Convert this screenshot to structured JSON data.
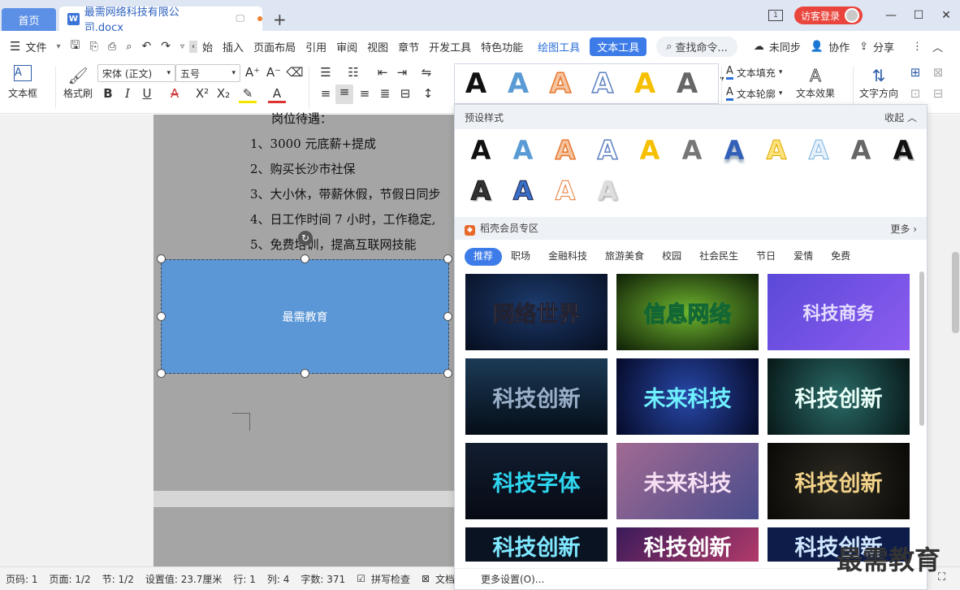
{
  "tabs": {
    "home": "首页",
    "doc_title": "最需网络科技有限公司.docx",
    "add": "+"
  },
  "titlebar": {
    "login": "访客登录",
    "page_icon": "1",
    "minimize": "—",
    "maximize": "☐",
    "close": "✕"
  },
  "menu": {
    "file": "文件",
    "items": [
      "始",
      "插入",
      "页面布局",
      "引用",
      "审阅",
      "视图",
      "章节",
      "开发工具",
      "特色功能"
    ],
    "draw_tool": "绘图工具",
    "text_tool": "文本工具",
    "search": "查找命令...",
    "sync": "未同步",
    "collab": "协作",
    "share": "分享"
  },
  "ribbon": {
    "textbox": "文本框",
    "format_brush": "格式刷",
    "font_name": "宋体 (正文)",
    "font_size": "五号",
    "bold": "B",
    "italic": "I",
    "underline": "U",
    "text_fill": "文本填充",
    "text_outline": "文本轮廓",
    "text_effect": "文本效果",
    "text_direction": "文字方向",
    "preset_glyph": "A"
  },
  "document": {
    "lines": [
      "岗位待遇：",
      "1、3000 元底薪+提成",
      "2、购买长沙市社保",
      "3、大小休，带薪休假，节假日同步",
      "4、日工作时间 7 小时，工作稳定,",
      "5、免费培训，提高互联网技能"
    ],
    "shape_text": "最需教育"
  },
  "panel": {
    "preset_title": "预设样式",
    "collapse": "收起",
    "vip_title": "稻壳会员专区",
    "more": "更多",
    "categories": [
      "推荐",
      "职场",
      "金融科技",
      "旅游美食",
      "校园",
      "社会民生",
      "节日",
      "爱情",
      "免费"
    ],
    "tiles": [
      "网络世界",
      "信息网络",
      "科技商务",
      "科技创新",
      "未来科技",
      "科技创新",
      "科技字体",
      "未来科技",
      "科技创新",
      "科技创新",
      "科技创新",
      "科技创新"
    ],
    "footer": "更多设置(O)..."
  },
  "status": {
    "page_num": "页码: 1",
    "pages": "页面: 1/2",
    "section": "节: 1/2",
    "setting": "设置值: 23.7厘米",
    "row": "行: 1",
    "col": "列: 4",
    "words": "字数: 371",
    "spell": "拼写检查",
    "doc": "文档"
  },
  "watermark": "最需教育",
  "colors": {
    "accent": "#3d7ce8",
    "tab_home": "#5c8fe6",
    "login": "#e9453d",
    "shape": "#5b97d6"
  }
}
